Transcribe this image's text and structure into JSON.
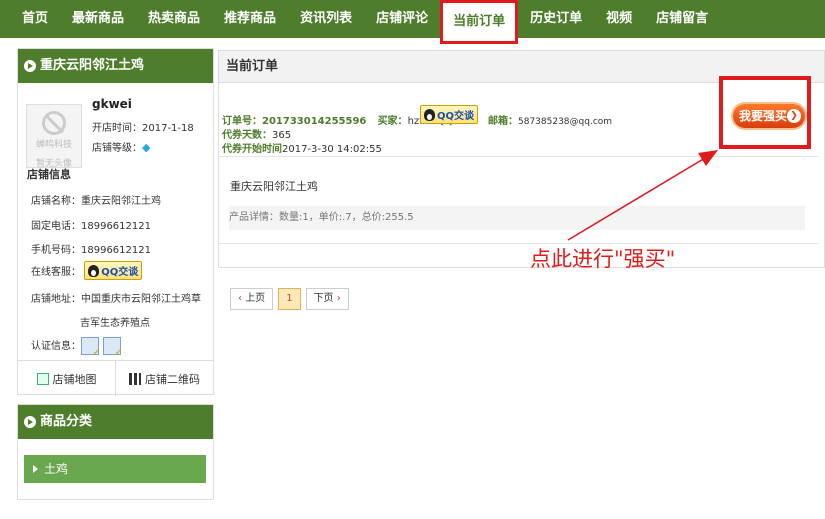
{
  "nav": {
    "items": [
      "首页",
      "最新商品",
      "热卖商品",
      "推荐商品",
      "资讯列表",
      "店铺评论",
      "当前订单",
      "历史订单",
      "视频",
      "店铺留言"
    ],
    "active_index": 6
  },
  "shop": {
    "title": "重庆云阳邻江土鸡",
    "avatar_text1": "蝉鸣科技",
    "avatar_text2": "暂无头像",
    "username": "gkwei",
    "open_time": "开店时间：2017-1-18",
    "level_label": "店铺等级：",
    "info_heading": "店铺信息",
    "name_label": "店铺名称：",
    "name_value": "重庆云阳邻江土鸡",
    "phone_label": "固定电话：",
    "phone_value": "18996612121",
    "mobile_label": "手机号码：",
    "mobile_value": "18996612121",
    "online_label": "在线客服：",
    "qq_label": "QQ交谈",
    "address_label": "店铺地址：",
    "address_line1": "中国重庆市云阳邻江土鸡草",
    "address_line2": "吉军生态养殖点",
    "cert_label": "认证信息：",
    "map_label": "店铺地图",
    "qr_label": "店铺二维码"
  },
  "category": {
    "title": "商品分类",
    "items": [
      "土鸡"
    ]
  },
  "order": {
    "title": "当前订单",
    "order_no_label": "订单号：",
    "order_no": "201733014255596",
    "buyer_label": "买家：",
    "buyer": "hzt",
    "qq_label": "QQ：",
    "qq_btn": "QQ交谈",
    "email_label": "邮箱：",
    "email": "587385238@qq.com",
    "days_label": "代券天数：",
    "days": "365",
    "start_label": "代券开始时间",
    "start": "2017-3-30 14:02:55",
    "shop_name": "重庆云阳邻江土鸡",
    "detail": "产品详情：数量:1，单价:.7，总价:255.5",
    "buy_label": "我要强买",
    "buy_arrow": "❯"
  },
  "pager": {
    "prev": "上页",
    "current": "1",
    "next": "下页"
  },
  "annotation": "点此进行\"强买\"",
  "colors": {
    "nav_bg": "#4e7d2c",
    "highlight": "#e11b1b",
    "buy_button": "#d93d0c"
  }
}
